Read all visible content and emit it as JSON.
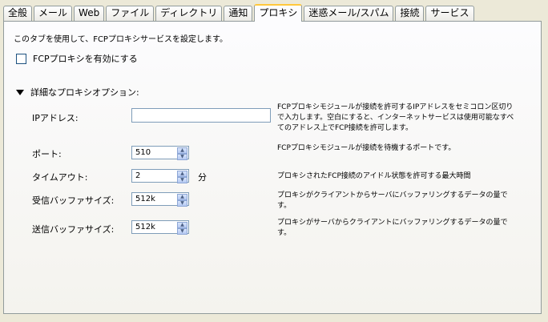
{
  "tabs": [
    "全般",
    "メール",
    "Web",
    "ファイル",
    "ディレクトリ",
    "通知",
    "プロキシ",
    "迷惑メール/スパム",
    "接続",
    "サービス"
  ],
  "active_tab": "プロキシ",
  "panel": {
    "description": "このタブを使用して、FCPプロキシサービスを設定します。",
    "enable_checkbox": {
      "label": "FCPプロキシを有効にする",
      "checked": false
    },
    "section_title": "詳細なプロキシオプション:",
    "ip": {
      "label": "IPアドレス:",
      "value": "",
      "help": "FCPプロキシモジュールが接続を許可するIPアドレスをセミコロン区切りで入力します。空白にすると、インターネットサービスは使用可能なすべてのアドレス上でFCP接続を許可します。"
    },
    "port": {
      "label": "ポート:",
      "value": "510",
      "help": "FCPプロキシモジュールが接続を待機するポートです。"
    },
    "timeout": {
      "label": "タイムアウト:",
      "value": "2",
      "unit": "分",
      "help": "プロキシされたFCP接続のアイドル状態を許可する最大時間"
    },
    "recv_buffer": {
      "label": "受信バッファサイズ:",
      "value": "512k",
      "help": "プロキシがクライアントからサーバにバッファリングするデータの量です。"
    },
    "send_buffer": {
      "label": "送信バッファサイズ:",
      "value": "512k",
      "help": "プロキシがサーバからクライアントにバッファリングするデータの量です。"
    }
  },
  "icons": {
    "spin_up": "arrow-up",
    "spin_down": "arrow-down",
    "section": "triangle-down"
  }
}
